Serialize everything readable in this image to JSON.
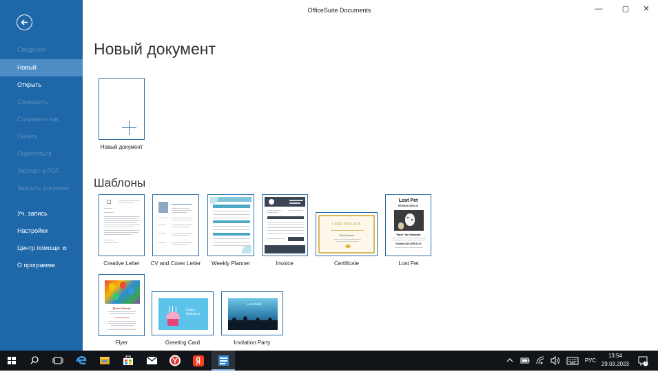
{
  "window": {
    "title": "OfficeSuite Documents",
    "controls": {
      "minimize": "—",
      "maximize": "▢",
      "close": "✕"
    }
  },
  "sidebar": {
    "items": [
      {
        "label": "Сведения",
        "state": "disabled"
      },
      {
        "label": "Новый",
        "state": "active"
      },
      {
        "label": "Открыть",
        "state": "enabled"
      },
      {
        "label": "Сохранить",
        "state": "disabled"
      },
      {
        "label": "Сохранить как",
        "state": "disabled"
      },
      {
        "label": "Печать",
        "state": "disabled"
      },
      {
        "label": "Поделиться",
        "state": "disabled"
      },
      {
        "label": "Экспорт в PDF",
        "state": "disabled"
      },
      {
        "label": "Закрыть документ",
        "state": "disabled"
      },
      {
        "label": "Уч. запись",
        "state": "enabled"
      },
      {
        "label": "Настройки",
        "state": "enabled"
      },
      {
        "label": "Центр помощи",
        "state": "enabled",
        "icon": "external-link-icon"
      },
      {
        "label": "О программе",
        "state": "enabled"
      }
    ]
  },
  "main": {
    "title": "Новый документ",
    "new_doc_label": "Новый документ",
    "templates_title": "Шаблоны",
    "templates": [
      {
        "name": "Creative Letter"
      },
      {
        "name": "CV and Cover Letter"
      },
      {
        "name": "Weekly Planner"
      },
      {
        "name": "Invoice"
      },
      {
        "name": "Certificate",
        "preview": {
          "heading": "CERTIFICATE",
          "recipient": "Shiel Bowel"
        }
      },
      {
        "name": "Lost Pet",
        "preview": {
          "heading": "Lost Pet",
          "reward": "REWARD $500.00",
          "caption": "\"Barry\" the Dalmatian",
          "contact": "Contact (321) 555-1212"
        }
      },
      {
        "name": "Flyer",
        "preview": {
          "heading": "[Event Name]"
        }
      },
      {
        "name": "Greeting Card",
        "preview": {
          "text": "Happy Birthday!!!"
        }
      },
      {
        "name": "Invitation Party",
        "preview": {
          "text": "Let's Party"
        }
      }
    ]
  },
  "taskbar": {
    "apps": [
      "windows-start-icon",
      "search-icon",
      "task-view-icon",
      "edge-icon",
      "file-explorer-icon",
      "store-icon",
      "mail-icon",
      "yandex-browser-icon",
      "yandex-icon",
      "officesuite-icon"
    ],
    "tray": {
      "language": "РУС",
      "time": "13:54",
      "date": "29.03.2023",
      "notifications": "1"
    }
  },
  "colors": {
    "sidebar": "#1e67a8",
    "sidebar_active": "#4c8dc6",
    "accent": "#2d6ea6",
    "taskbar": "#111418"
  }
}
